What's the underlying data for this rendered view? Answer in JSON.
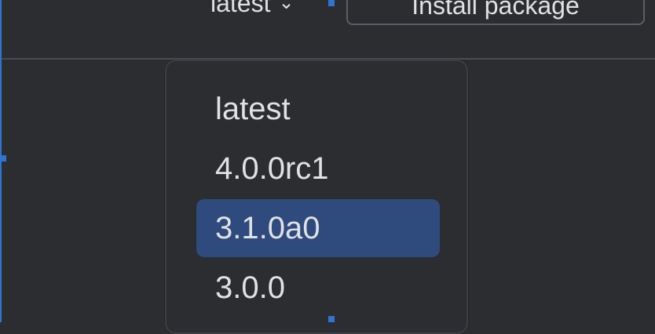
{
  "top_bar": {
    "version_label": "latest",
    "chevron_icon": "chevron-down-icon",
    "install_button_label": "Install package"
  },
  "dropdown": {
    "items": [
      {
        "label": "latest"
      },
      {
        "label": "4.0.0rc1"
      },
      {
        "label": "3.1.0a0"
      },
      {
        "label": "3.0.0"
      }
    ],
    "selected_label": "3.1.0a0"
  },
  "colors": {
    "background": "#2b2d30",
    "text": "#dfe1e5",
    "selection": "#2f4a7c",
    "handle": "#2f74d0"
  }
}
